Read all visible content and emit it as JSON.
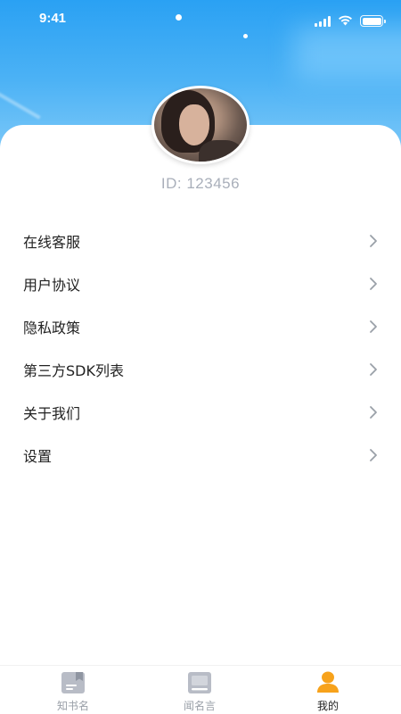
{
  "status_bar": {
    "time": "9:41"
  },
  "profile": {
    "id_text": "ID: 123456"
  },
  "menu": {
    "items": [
      {
        "label": "在线客服"
      },
      {
        "label": "用户协议"
      },
      {
        "label": "隐私政策"
      },
      {
        "label": "第三方SDK列表"
      },
      {
        "label": "关于我们"
      },
      {
        "label": "设置"
      }
    ]
  },
  "tabbar": {
    "tabs": [
      {
        "label": "知书名",
        "icon": "book-icon",
        "active": false
      },
      {
        "label": "闻名言",
        "icon": "notebook-icon",
        "active": false
      },
      {
        "label": "我的",
        "icon": "person-icon",
        "active": true
      }
    ]
  },
  "colors": {
    "header_top": "#2aa1f3",
    "header_bottom": "#8dd0f9",
    "accent_active_tab": "#f7a21b",
    "inactive_icon": "#b8bcc6",
    "id_text": "#a9afba",
    "chevron": "#9aa0a8"
  }
}
